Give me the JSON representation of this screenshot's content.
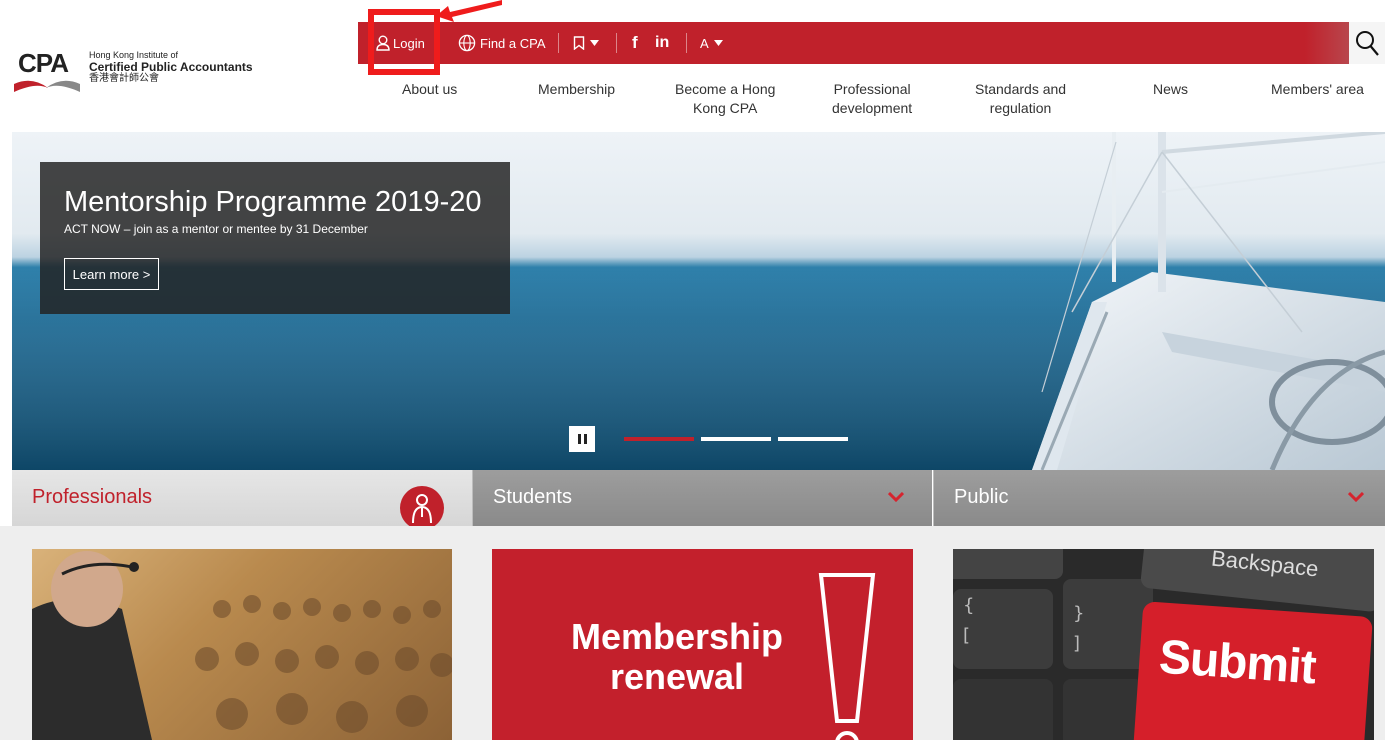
{
  "logo": {
    "abbr": "CPA",
    "line1": "Hong Kong Institute of",
    "line2": "Certified Public Accountants",
    "line3": "香港會計師公會"
  },
  "topbar": {
    "login": "Login",
    "find_cpa": "Find a CPA",
    "facebook": "f",
    "linkedin": "in",
    "font_size": "A"
  },
  "nav": {
    "about": "About us",
    "membership": "Membership",
    "become_line1": "Become a Hong",
    "become_line2": "Kong CPA",
    "profdev_line1": "Professional",
    "profdev_line2": "development",
    "standards_line1": "Standards and",
    "standards_line2": "regulation",
    "news": "News",
    "members_area": "Members' area"
  },
  "hero": {
    "title": "Mentorship Programme 2019-20",
    "subtitle": "ACT NOW – join as a mentor or mentee by 31 December",
    "button": "Learn more >",
    "active_slide": 1,
    "slide_count": 3
  },
  "tabs": {
    "professionals": "Professionals",
    "students": "Students",
    "public": "Public"
  },
  "cards": {
    "renewal_line1": "Membership",
    "renewal_line2": "renewal",
    "keyboard_key": "Backspace",
    "keyboard_submit": "Submit"
  },
  "colors": {
    "brand_red": "#c0212b",
    "highlight": "#ef1c1c"
  },
  "icons": [
    "user-icon",
    "globe-icon",
    "bookmark-icon",
    "caret-down-icon",
    "facebook-icon",
    "linkedin-icon",
    "search-icon",
    "pause-icon",
    "person-icon",
    "chevron-down-icon",
    "arrow-icon"
  ]
}
